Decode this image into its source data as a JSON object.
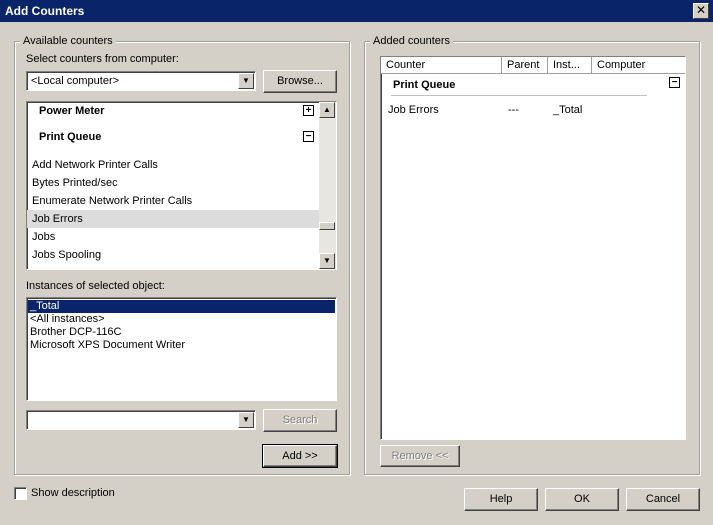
{
  "window": {
    "title": "Add Counters",
    "close_glyph": "✕"
  },
  "available": {
    "group_label": "Available counters",
    "computer_label": "Select counters from computer:",
    "computer_value": "<Local computer>",
    "browse_label": "Browse...",
    "objects": [
      {
        "label": "Power Meter",
        "type": "category",
        "expander": "+"
      },
      {
        "label": "Print Queue",
        "type": "category",
        "expander": "−"
      },
      {
        "label": "Add Network Printer Calls",
        "type": "counter"
      },
      {
        "label": "Bytes Printed/sec",
        "type": "counter"
      },
      {
        "label": "Enumerate Network Printer Calls",
        "type": "counter"
      },
      {
        "label": "Job Errors",
        "type": "counter",
        "selected": true
      },
      {
        "label": "Jobs",
        "type": "counter"
      },
      {
        "label": "Jobs Spooling",
        "type": "counter"
      }
    ],
    "instances_label": "Instances of selected object:",
    "instances": [
      {
        "label": "_Total",
        "selected": true
      },
      {
        "label": "<All instances>"
      },
      {
        "label": "Brother DCP-116C"
      },
      {
        "label": "Microsoft XPS Document Writer"
      }
    ],
    "search_value": "",
    "search_label": "Search",
    "add_label": "Add >>"
  },
  "added": {
    "group_label": "Added counters",
    "columns": [
      "Counter",
      "Parent",
      "Inst...",
      "Computer"
    ],
    "group_row": {
      "label": "Print Queue",
      "expander": "−"
    },
    "rows": [
      {
        "counter": "Job Errors",
        "parent": "---",
        "instance": "_Total",
        "computer": ""
      }
    ],
    "remove_label": "Remove <<"
  },
  "footer": {
    "show_description_label": "Show description",
    "help_label": "Help",
    "ok_label": "OK",
    "cancel_label": "Cancel"
  },
  "colors": {
    "title_bar": "#0a246a",
    "selection": "#0a246a",
    "face": "#d4d0c8",
    "hover_row": "#dcdcdc"
  },
  "scroll": {
    "objects_list_position": 0.82
  }
}
